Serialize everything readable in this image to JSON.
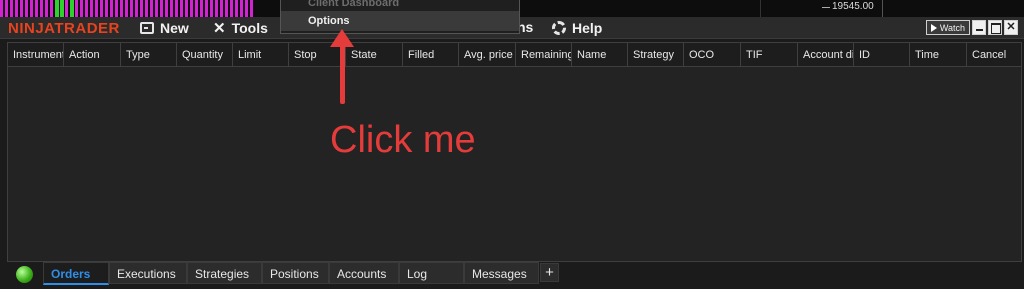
{
  "chart_strip": {
    "price_label": "19545.00"
  },
  "menubar": {
    "brand": "NINJATRADER",
    "items": [
      {
        "label": "New",
        "icon": "new-window-icon"
      },
      {
        "label": "Tools",
        "icon": "tools-icon"
      },
      {
        "label": "Help",
        "icon": "help-icon"
      }
    ],
    "partial_hidden_text": "ns",
    "window_controls": {
      "watch_label": "Watch"
    }
  },
  "dropdown": {
    "items": [
      {
        "label": "Client Dashboard",
        "disabled": true
      },
      {
        "label": "Options",
        "highlighted": true
      }
    ]
  },
  "orders_grid": {
    "columns": [
      "Instrument",
      "Action",
      "Type",
      "Quantity",
      "Limit",
      "Stop",
      "State",
      "Filled",
      "Avg. price",
      "Remaining",
      "Name",
      "Strategy",
      "OCO",
      "TIF",
      "Account display name",
      "ID",
      "Time",
      "Cancel"
    ]
  },
  "annotation": {
    "callout_text": "Click me",
    "color": "#e43b3b"
  },
  "tabs": {
    "items": [
      "Orders",
      "Executions",
      "Strategies",
      "Positions",
      "Accounts",
      "Log",
      "Messages"
    ],
    "active": "Orders",
    "add_label": "+"
  },
  "colors": {
    "brand": "#e8431e",
    "active_tab": "#2f8fe8",
    "connection_status": "#3db11a"
  }
}
